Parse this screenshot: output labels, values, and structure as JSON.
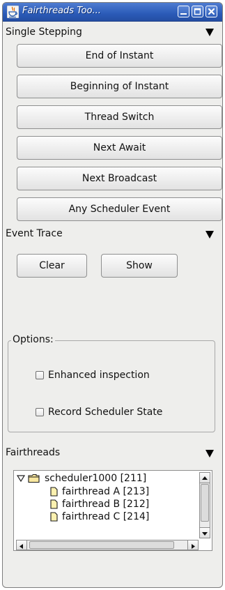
{
  "window": {
    "title": "Fairthreads Too...",
    "accent_color": "#2b5bb8",
    "controls": [
      "minimize-icon",
      "maximize-icon",
      "close-icon"
    ]
  },
  "single_stepping": {
    "label": "Single Stepping",
    "buttons": [
      "End of Instant",
      "Beginning of Instant",
      "Thread Switch",
      "Next Await",
      "Next Broadcast",
      "Any Scheduler Event"
    ]
  },
  "event_trace": {
    "label": "Event Trace",
    "clear_label": "Clear",
    "show_label": "Show"
  },
  "options": {
    "legend": "Options:",
    "enhanced_inspection": {
      "label": "Enhanced inspection",
      "checked": false
    },
    "record_scheduler_state": {
      "label": "Record Scheduler State",
      "checked": false
    }
  },
  "fairthreads": {
    "label": "Fairthreads",
    "root": {
      "label": "scheduler1000 [211]",
      "expanded": true
    },
    "children": [
      "fairthread A [213]",
      "fairthread B [212]",
      "fairthread C [214]"
    ]
  }
}
